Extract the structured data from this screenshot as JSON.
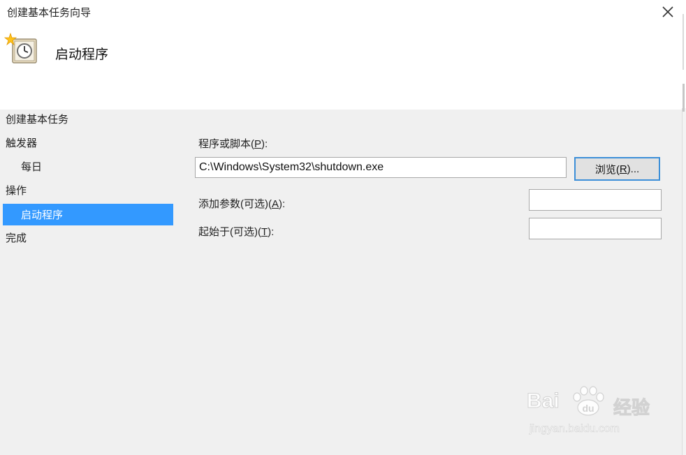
{
  "window": {
    "title": "创建基本任务向导",
    "close_glyph": "✕"
  },
  "header": {
    "icon": "task-clock-icon",
    "title": "启动程序"
  },
  "sidebar": {
    "heading": "创建基本任务",
    "steps": [
      {
        "label": "触发器"
      },
      {
        "label": "每日"
      },
      {
        "label": "操作"
      },
      {
        "label": "启动程序",
        "selected": true
      },
      {
        "label": "完成"
      }
    ]
  },
  "form": {
    "program_label_prefix": "程序或脚本(",
    "program_label_key": "P",
    "program_label_suffix": "):",
    "program_value": "C:\\Windows\\System32\\shutdown.exe",
    "browse_prefix": "浏览(",
    "browse_key": "R",
    "browse_suffix": ")...",
    "args_label_prefix": "添加参数(可选)(",
    "args_label_key": "A",
    "args_label_suffix": "):",
    "args_value": "",
    "start_label_prefix": "起始于(可选)(",
    "start_label_key": "T",
    "start_label_suffix": "):",
    "start_value": ""
  },
  "watermark": {
    "brand": "Bai",
    "brand2": "经验",
    "url": "jingyan.baidu.com"
  },
  "colors": {
    "selection": "#3399ff",
    "button_focus": "#3c8fd8"
  }
}
